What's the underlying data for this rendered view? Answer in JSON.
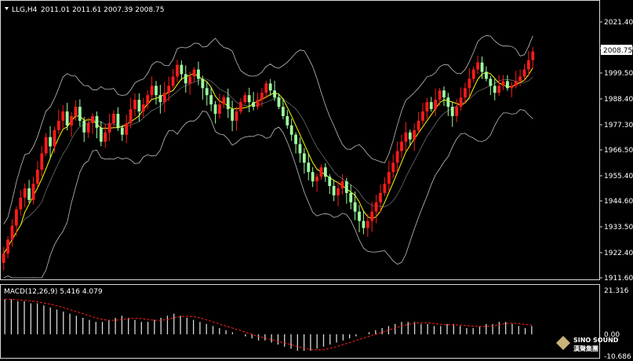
{
  "header": {
    "symbol_label": "LLG,H4",
    "values_text": "2011.01 2011.61 2007.39 2008.75"
  },
  "macd": {
    "label": "MACD(12,26,9) 5.416 4.079"
  },
  "logo": {
    "text": "SINO SOUND",
    "subtext": "漢聲集團"
  },
  "colors": {
    "background": "#000000",
    "bull": "#ff1b1b",
    "bear": "#9dffa0",
    "ma": "#ffff00",
    "bands": "#bfbfbf",
    "macd_hist": "#d8d8d8",
    "signal": "#ff2020"
  },
  "chart_data": [
    {
      "type": "candlestick",
      "title": "LLG,H4",
      "y_ticks": [
        "2021.40",
        "2010.20",
        "1999.50",
        "1988.40",
        "1977.30",
        "1966.50",
        "1955.40",
        "1944.60",
        "1933.50",
        "1922.40",
        "1911.60"
      ],
      "ylim": [
        1911.6,
        2021.4
      ],
      "last_price": "2008.75",
      "moving_average": "yellow",
      "bollinger_bands": "gray",
      "closes": [
        1922,
        1928,
        1934,
        1941,
        1946,
        1950,
        1945,
        1952,
        1958,
        1965,
        1972,
        1968,
        1975,
        1979,
        1983,
        1977,
        1981,
        1985,
        1979,
        1974,
        1978,
        1981,
        1976,
        1970,
        1974,
        1978,
        1982,
        1976,
        1973,
        1978,
        1984,
        1988,
        1983,
        1986,
        1990,
        1994,
        1990,
        1987,
        1991,
        1994,
        1998,
        2003,
        1999,
        1995,
        1998,
        2001,
        1997,
        1993,
        1990,
        1986,
        1982,
        1986,
        1989,
        1984,
        1979,
        1983,
        1987,
        1990,
        1987,
        1985,
        1988,
        1991,
        1995,
        1992,
        1989,
        1985,
        1981,
        1977,
        1973,
        1969,
        1965,
        1961,
        1957,
        1953,
        1955,
        1959,
        1955,
        1951,
        1947,
        1950,
        1953,
        1948,
        1944,
        1940,
        1936,
        1933,
        1936,
        1940,
        1944,
        1948,
        1952,
        1957,
        1961,
        1966,
        1970,
        1974,
        1971,
        1975,
        1979,
        1983,
        1987,
        1984,
        1988,
        1992,
        1989,
        1985,
        1981,
        1985,
        1989,
        1993,
        1997,
        2001,
        2004,
        2000,
        1997,
        1994,
        1991,
        1994,
        1996,
        1993,
        1994,
        1996,
        1998,
        2001,
        2005,
        2008.75
      ],
      "macd_ticks": [
        "21.316",
        "0.00",
        "-10.686"
      ],
      "macd_ylim": [
        -10.686,
        21.316
      ],
      "macd": [
        17,
        17,
        16,
        16,
        15,
        15,
        14,
        13,
        12,
        11,
        10,
        9,
        8,
        7,
        6,
        6,
        7,
        8,
        9,
        8,
        7,
        6,
        6,
        7,
        8,
        9,
        10,
        9,
        8,
        7,
        6,
        5,
        4,
        3,
        2,
        1,
        0,
        -1,
        -2,
        -3,
        -3,
        -4,
        -5,
        -6,
        -7,
        -8,
        -8,
        -8,
        -7,
        -6,
        -5,
        -4,
        -3,
        -2,
        -1,
        0,
        1,
        2,
        3,
        4,
        5,
        6,
        6,
        6,
        5,
        5,
        4,
        4,
        5,
        5,
        4,
        3,
        3,
        4,
        5,
        5,
        6,
        6,
        5,
        4,
        3,
        4
      ]
    }
  ]
}
